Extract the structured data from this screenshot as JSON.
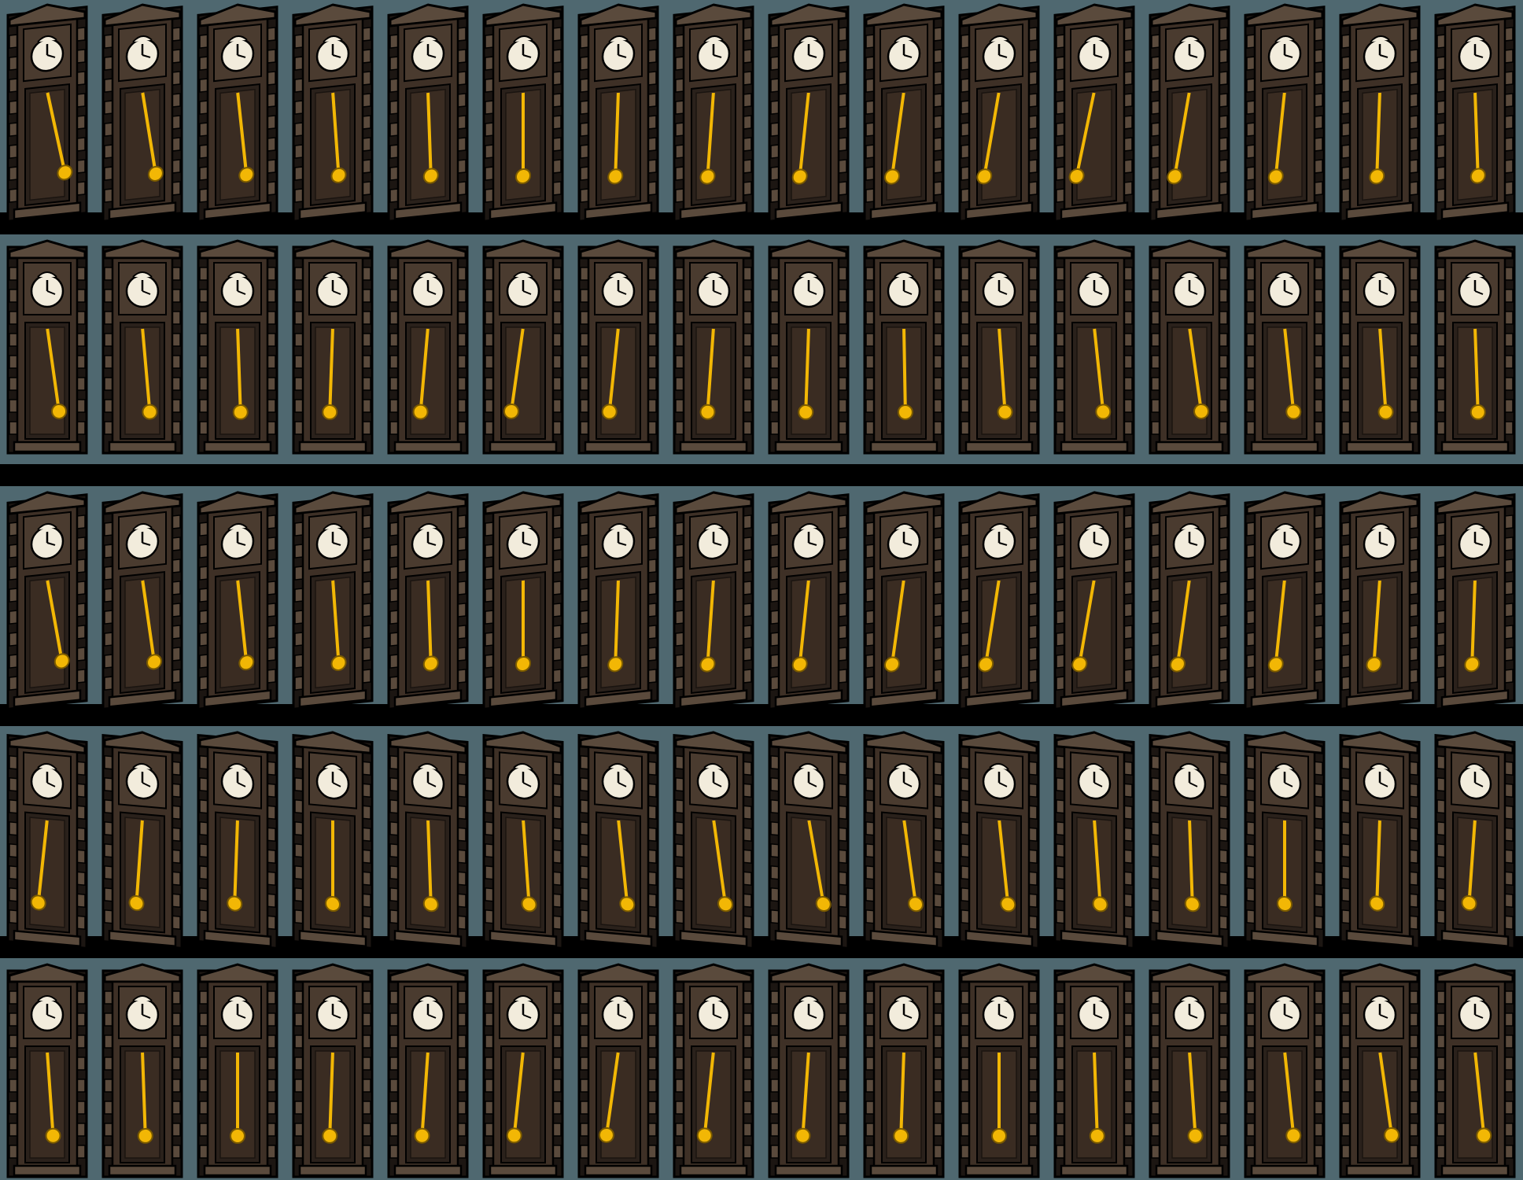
{
  "sprite_sheet": {
    "rows": 5,
    "columns": 16,
    "background_color": "#4f6870",
    "shadow_color": "#000000",
    "sprite": "grandfather-clock",
    "wood_color": "#3e3026",
    "wood_dark_color": "#1c1612",
    "wood_light_color": "#5a4a3c",
    "dial_color": "#f2ecdc",
    "pendulum_color": "#f2b705",
    "row_variants": [
      {
        "view": "tilted-left",
        "clock_hand": "clock-face-icon"
      },
      {
        "view": "front",
        "clock_hand": "clock-face-icon"
      },
      {
        "view": "tilted-left",
        "clock_hand": "clock-face-icon"
      },
      {
        "view": "tilted-right",
        "clock_hand": "clock-face-icon"
      },
      {
        "view": "front",
        "clock_hand": "clock-face-icon"
      }
    ],
    "pendulum_angles_deg": [
      [
        -12,
        -9,
        -6,
        -4,
        -2,
        0,
        2,
        4,
        6,
        8,
        10,
        12,
        10,
        6,
        2,
        -2
      ],
      [
        -8,
        -5,
        -2,
        2,
        5,
        8,
        6,
        4,
        2,
        -1,
        -4,
        -6,
        -8,
        -6,
        -4,
        -2
      ],
      [
        -10,
        -8,
        -6,
        -4,
        -2,
        0,
        2,
        4,
        6,
        8,
        9,
        10,
        8,
        6,
        4,
        2
      ],
      [
        6,
        4,
        2,
        0,
        -2,
        -4,
        -6,
        -8,
        -10,
        -8,
        -6,
        -4,
        -2,
        0,
        2,
        4
      ],
      [
        -4,
        -2,
        0,
        2,
        4,
        6,
        8,
        6,
        4,
        2,
        0,
        -2,
        -4,
        -6,
        -8,
        -6
      ]
    ]
  }
}
